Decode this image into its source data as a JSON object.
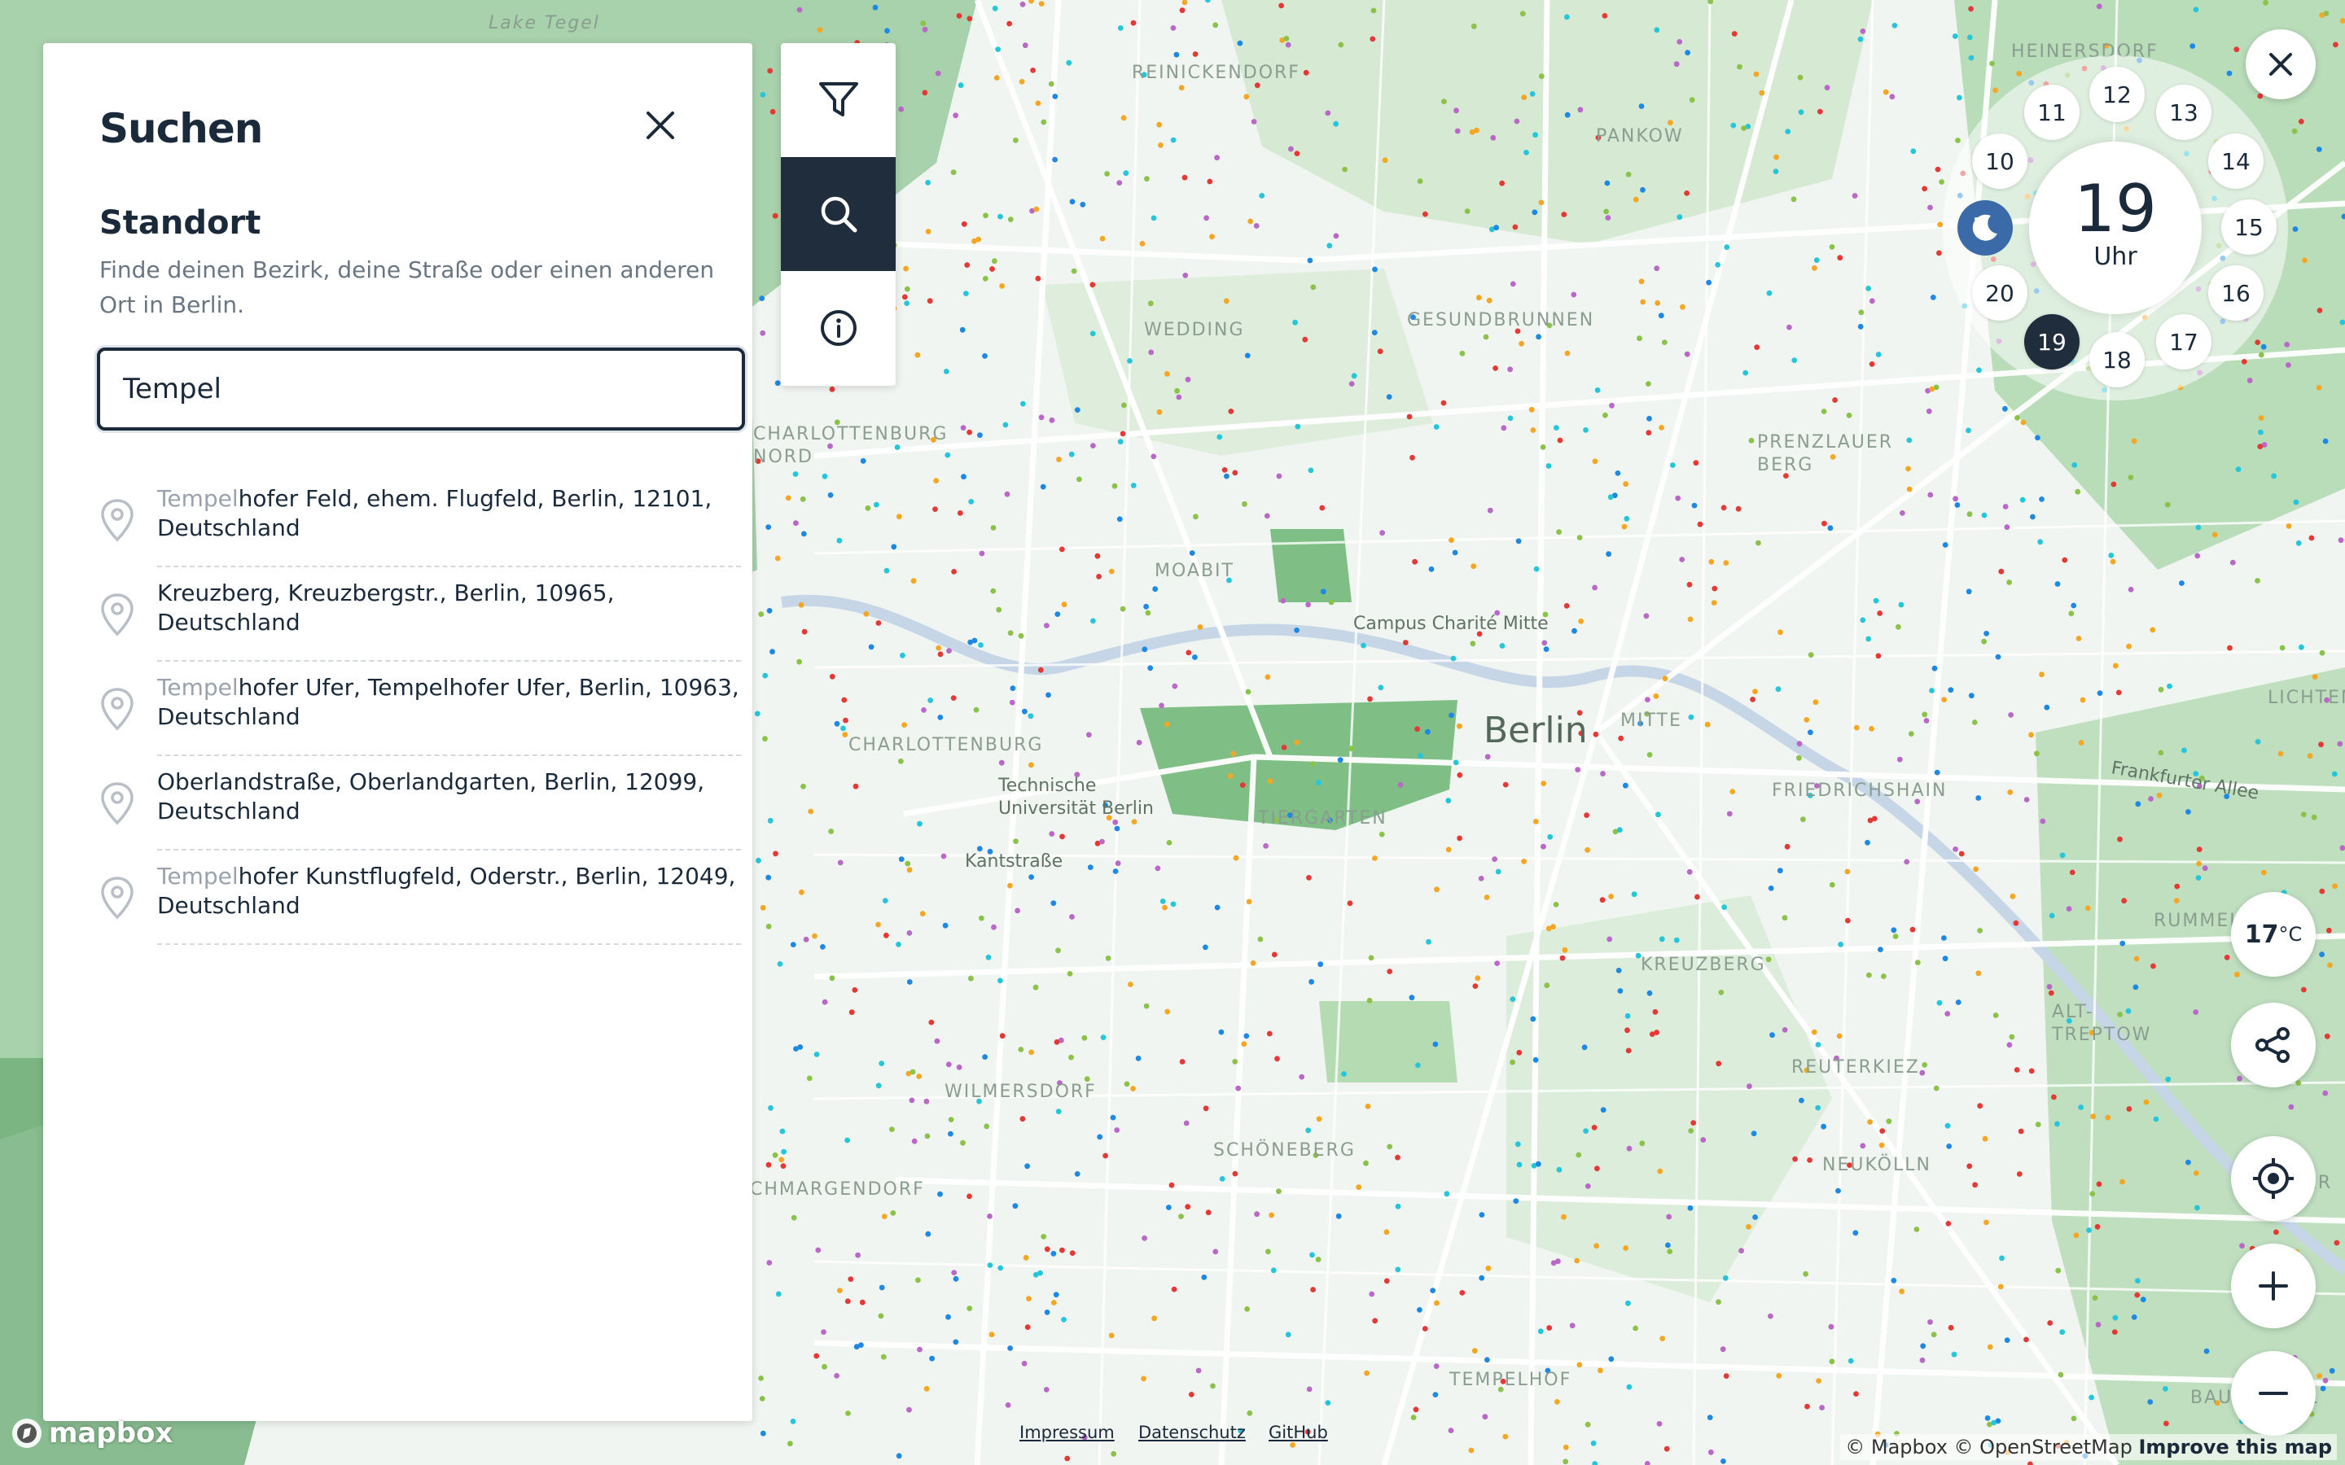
{
  "panel": {
    "title": "Suchen",
    "section_title": "Standort",
    "section_desc": "Finde deinen Bezirk, deine Straße oder einen anderen Ort in Berlin.",
    "search_value": "Tempel",
    "results": [
      {
        "highlight": "Tempel",
        "rest": "hofer Feld, ehem. Flugfeld, Berlin, 12101, Deutschland"
      },
      {
        "highlight": "",
        "rest": "Kreuzberg, Kreuzbergstr., Berlin, 10965, Deutschland"
      },
      {
        "highlight": "Tempel",
        "rest": "hofer Ufer, Tempelhofer Ufer, Berlin, 10963, Deutschland"
      },
      {
        "highlight": "",
        "rest": "Oberlandstraße, Oberlandgarten, Berlin, 12099, Deutschland"
      },
      {
        "highlight": "Tempel",
        "rest": "hofer Kunstflugfeld, Oderstr., Berlin, 12049, Deutschland"
      }
    ]
  },
  "toolbar": {
    "items": [
      "filter-icon",
      "search-icon",
      "info-icon"
    ],
    "active": "search-icon"
  },
  "dial": {
    "hour": "19",
    "unit": "Uhr",
    "hours": [
      "11",
      "12",
      "13",
      "10",
      "14",
      "15",
      "20",
      "16",
      "19",
      "17",
      "18"
    ],
    "selected": "19"
  },
  "weather": {
    "temp": "17",
    "unit": "°C"
  },
  "map_controls": [
    "share-icon",
    "locate-icon",
    "zoom-in-icon",
    "zoom-out-icon"
  ],
  "map_labels": {
    "lake": "Lake Tegel",
    "reinickendorf": "REINICKENDORF",
    "heinersdorf": "HEINERSDORF",
    "pankow": "PANKOW",
    "wedding": "WEDDING",
    "gesundbrunnen": "GESUNDBRUNNEN",
    "charlottenburg_nord": "CHARLOTTENBURG\nNORD",
    "prenzlauer": "PRENZLAUER\nBERG",
    "moabit": "MOABIT",
    "charite": "Campus Charité Mitte",
    "berlin": "Berlin",
    "mitte": "MITTE",
    "charlottenburg": "CHARLOTTENBURG",
    "tu": "Technische\nUniversität Berlin",
    "tiergarten": "TIERGARTEN",
    "friedrichshain": "FRIEDRICHSHAIN",
    "frankfurter": "Frankfurter Allee",
    "lichtenberg": "LICHTEN",
    "kantstrasse": "Kantstraße",
    "kreuzberg": "KREUZBERG",
    "rummelsburg": "RUMMELSB",
    "wilmersdorf": "WILMERSDORF",
    "treptow": "ALT-\nTREPTOW",
    "reuterkiez": "REUTERKIEZ",
    "schoeneberg": "SCHÖNEBERG",
    "neukoelln": "NEUKÖLLN",
    "schmargendorf": "SCHMARGENDORF",
    "plaenterwald": "PLÄNTER",
    "tempelhof": "TEMPELHOF",
    "baumschul": "BAUMSCHUL"
  },
  "footer": {
    "impressum": "Impressum",
    "datenschutz": "Datenschutz",
    "github": "GitHub",
    "attribution": "© Mapbox © OpenStreetMap",
    "improve": "Improve this map",
    "logo": "mapbox"
  },
  "colors": {
    "brand_dark": "#1f2d3d",
    "map_green": "#9fcf9f",
    "dot_colors": [
      "#f5a623",
      "#8bc34a",
      "#26c6da",
      "#1e88e5",
      "#e53935",
      "#ba68c8"
    ]
  }
}
